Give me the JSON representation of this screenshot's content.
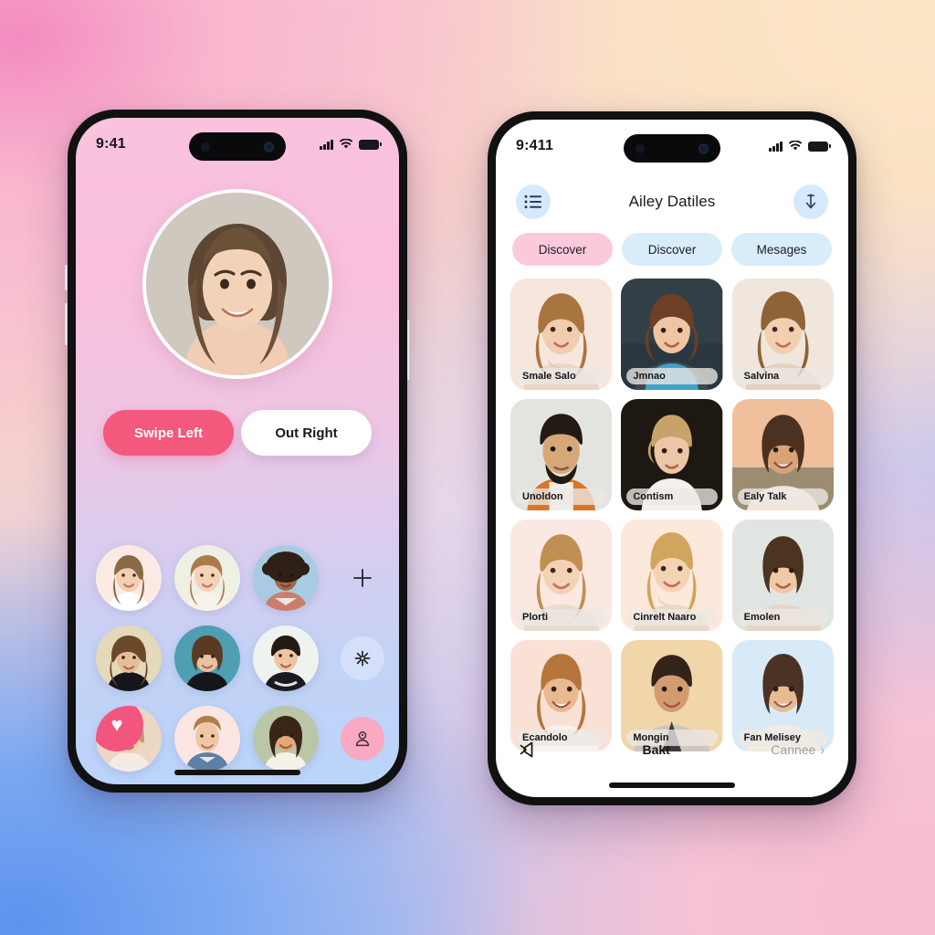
{
  "background": {
    "top_left_color": "#f48cc0",
    "top_right_color": "#fbe3c4",
    "bottom_left_color": "#5d93ee",
    "bottom_right_color": "#f7bcd0"
  },
  "left_phone": {
    "status": {
      "time": "9:41",
      "signal_icon": "cellular-signal-icon",
      "wifi_icon": "wifi-icon",
      "battery_icon": "battery-icon"
    },
    "hero": {
      "avatar_name": "profile-photo"
    },
    "buttons": [
      {
        "label": "Swipe Left",
        "style": "primary",
        "color": "#f4587c"
      },
      {
        "label": "Out Right",
        "style": "secondary",
        "color": "#ffffff"
      }
    ],
    "grid": {
      "rows": [
        {
          "avatars": [
            "avatar-1",
            "avatar-2",
            "avatar-3"
          ],
          "rail_icon": "plus-icon",
          "rail_style": "plain"
        },
        {
          "avatars": [
            "avatar-4",
            "avatar-5",
            "avatar-6"
          ],
          "rail_icon": "sparkle-icon",
          "rail_style": "ghost"
        },
        {
          "avatars": [
            "avatar-7",
            "avatar-8",
            "avatar-9"
          ],
          "rail_icon": "person-icon",
          "rail_style": "pink"
        }
      ],
      "badge_glyph": "♥"
    }
  },
  "right_phone": {
    "status": {
      "time": "9:411",
      "signal_icon": "cellular-signal-icon",
      "wifi_icon": "wifi-icon",
      "battery_icon": "battery-icon"
    },
    "header": {
      "menu_icon": "list-menu-icon",
      "title": "Ailey Datiles",
      "action_icon": "download-arrow-icon"
    },
    "tabs": [
      {
        "label": "Discover",
        "active": true,
        "color": "#fbc9dc"
      },
      {
        "label": "Discover",
        "active": false,
        "color": "#d9ecfa"
      },
      {
        "label": "Mesages",
        "active": false,
        "color": "#d9ecfa"
      }
    ],
    "cards": [
      {
        "name": "Smale Salo",
        "bg": "#f6e3dc"
      },
      {
        "name": "Jmnao",
        "bg": "#2f3a42"
      },
      {
        "name": "Salvina",
        "bg": "#efe5dd"
      },
      {
        "name": "Unoldon",
        "bg": "#e2e3df"
      },
      {
        "name": "Contism",
        "bg": "#1b1713"
      },
      {
        "name": "Ealy Talk",
        "bg": "#f0c1a4"
      },
      {
        "name": "Plorti",
        "bg": "#fae6e0"
      },
      {
        "name": "Cinrelt Naaro",
        "bg": "#fbe8dc"
      },
      {
        "name": "Emolen",
        "bg": "#dfe4e0"
      },
      {
        "name": "Ecandolo",
        "bg": "#fae0d7"
      },
      {
        "name": "Mongin",
        "bg": "#f4ddc3"
      },
      {
        "name": "Fan Melisey",
        "bg": "#d7e9f7"
      }
    ],
    "footer": {
      "left_icon": "mute-speaker-icon",
      "center_label": "Bakt",
      "right_label": "Cannee",
      "right_chevron": "›"
    }
  }
}
